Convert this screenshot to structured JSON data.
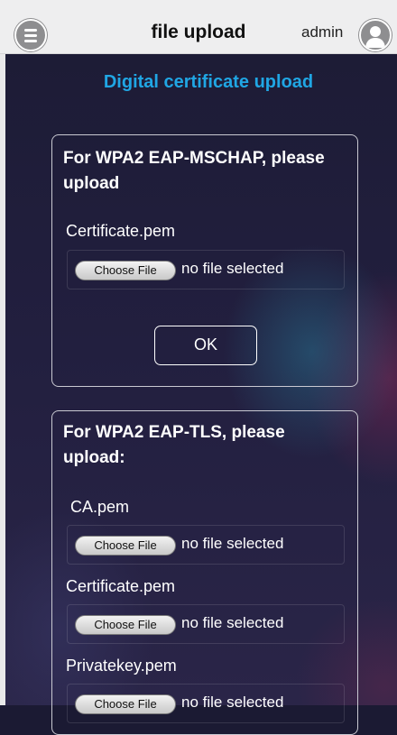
{
  "header": {
    "title": "file upload",
    "user": "admin",
    "menu_icon": "menu-icon",
    "avatar_icon": "user-icon"
  },
  "page": {
    "title": "Digital certificate upload"
  },
  "mschap": {
    "heading": "For WPA2 EAP-MSCHAP, please upload",
    "fields": [
      {
        "label": "Certificate.pem",
        "button": "Choose File",
        "status": "no file selected"
      }
    ],
    "ok_label": "OK"
  },
  "tls": {
    "heading": "For WPA2 EAP-TLS, please upload:",
    "fields": [
      {
        "label": "CA.pem",
        "button": "Choose File",
        "status": "no file selected"
      },
      {
        "label": "Certificate.pem",
        "button": "Choose File",
        "status": "no file selected"
      },
      {
        "label": "Privatekey.pem",
        "button": "Choose File",
        "status": "no file selected"
      }
    ]
  },
  "colors": {
    "accent": "#20a6e4",
    "background": "#1d1c36",
    "header": "#eeeeef"
  }
}
